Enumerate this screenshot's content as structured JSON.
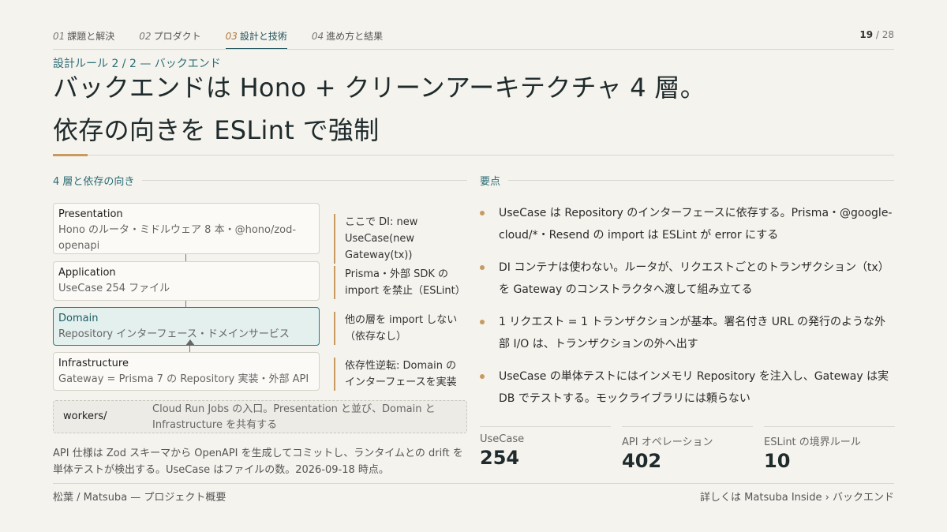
{
  "nav": {
    "tabs": [
      {
        "num": "01",
        "label": "課題と解決"
      },
      {
        "num": "02",
        "label": "プロダクト"
      },
      {
        "num": "03",
        "label": "設計と技術"
      },
      {
        "num": "04",
        "label": "進め方と結果"
      }
    ],
    "active_index": 2,
    "page_current": "19",
    "page_sep": " / ",
    "page_total": "28"
  },
  "header": {
    "eyebrow": "設計ルール 2 / 2 — バックエンド",
    "title_line1": "バックエンドは Hono + クリーンアーキテクチャ 4 層。",
    "title_line2": "依存の向きを ESLint で強制"
  },
  "left": {
    "heading": "4 層と依存の向き",
    "layers": [
      {
        "name": "Presentation",
        "desc": "Hono のルータ・ミドルウェア 8 本・@hono/zod-openapi",
        "note": "ここで DI: new UseCase(new Gateway(tx))"
      },
      {
        "name": "Application",
        "desc": "UseCase 254 ファイル",
        "note": "Prisma・外部 SDK の import を禁止（ESLint）"
      },
      {
        "name": "Domain",
        "desc": "Repository インターフェース・ドメインサービス",
        "note": "他の層を import しない（依存なし）"
      },
      {
        "name": "Infrastructure",
        "desc": "Gateway = Prisma 7 の Repository 実装・外部 API",
        "note": "依存性逆転: Domain のインターフェースを実装"
      }
    ],
    "workers": {
      "label": "workers/",
      "desc": "Cloud Run Jobs の入口。Presentation と並び、Domain と Infrastructure を共有する"
    },
    "footnote": "API 仕様は Zod スキーマから OpenAPI を生成してコミットし、ランタイムとの drift を単体テストが検出する。UseCase はファイルの数。2026-09-18 時点。"
  },
  "right": {
    "heading": "要点",
    "bullets": [
      "UseCase は Repository のインターフェースに依存する。Prisma・@google-cloud/*・Resend の import は ESLint が error にする",
      "DI コンテナは使わない。ルータが、リクエストごとのトランザクション（tx）を Gateway のコンストラクタへ渡して組み立てる",
      "1 リクエスト = 1 トランザクションが基本。署名付き URL の発行のような外部 I/O は、トランザクションの外へ出す",
      "UseCase の単体テストにはインメモリ Repository を注入し、Gateway は実 DB でテストする。モックライブラリには頼らない"
    ],
    "stats": [
      {
        "label": "UseCase",
        "value": "254"
      },
      {
        "label": "API オペレーション",
        "value": "402"
      },
      {
        "label": "ESLint の境界ルール",
        "value": "10"
      }
    ]
  },
  "footer": {
    "left": "松葉 / Matsuba — プロジェクト概要",
    "right": "詳しくは Matsuba Inside › バックエンド"
  },
  "colors": {
    "background": "#f4f3ee",
    "accent_teal": "#2c6c74",
    "accent_gold": "#c89a5f",
    "domain_fill": "#e3f0ee"
  }
}
